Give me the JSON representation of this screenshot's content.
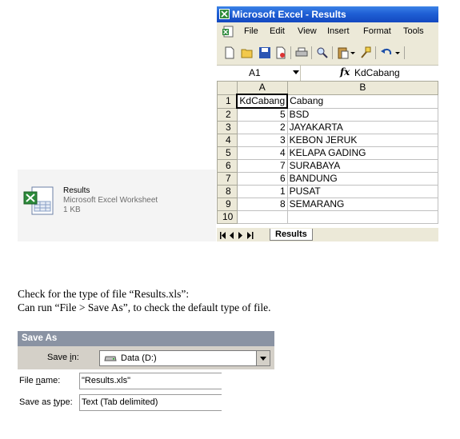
{
  "file": {
    "name": "Results",
    "type": "Microsoft Excel Worksheet",
    "size": "1 KB"
  },
  "excel": {
    "title": "Microsoft Excel - Results",
    "menu": [
      "File",
      "Edit",
      "View",
      "Insert",
      "Format",
      "Tools"
    ],
    "name_box": "A1",
    "fx_symbol": "fx",
    "formula_value": "KdCabang",
    "columns": [
      "A",
      "B"
    ],
    "rows": [
      {
        "n": "1",
        "a": "KdCabang",
        "b": "Cabang"
      },
      {
        "n": "2",
        "a": "5",
        "b": "BSD"
      },
      {
        "n": "3",
        "a": "2",
        "b": "JAYAKARTA"
      },
      {
        "n": "4",
        "a": "3",
        "b": "KEBON JERUK"
      },
      {
        "n": "5",
        "a": "4",
        "b": "KELAPA GADING"
      },
      {
        "n": "6",
        "a": "7",
        "b": "SURABAYA"
      },
      {
        "n": "7",
        "a": "6",
        "b": "BANDUNG"
      },
      {
        "n": "8",
        "a": "1",
        "b": "PUSAT"
      },
      {
        "n": "9",
        "a": "8",
        "b": "SEMARANG"
      },
      {
        "n": "10",
        "a": "",
        "b": ""
      }
    ],
    "sheet_tab": "Results"
  },
  "notes": {
    "line1": "Check for the type of file “Results.xls”:",
    "line2": "Can run “File > Save As”, to check the default type of file."
  },
  "save_as": {
    "title": "Save As",
    "save_in_label": "Save in:",
    "save_in_value": "Data (D:)",
    "file_name_label": "File name:",
    "file_name_value": "\"Results.xls\"",
    "save_type_label": "Save as type:",
    "save_type_value": "Text (Tab delimited)"
  }
}
